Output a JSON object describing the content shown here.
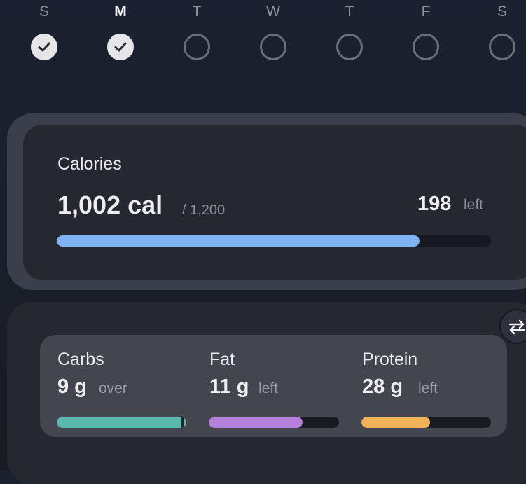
{
  "week": {
    "days": [
      {
        "letter": "S",
        "done": true
      },
      {
        "letter": "M",
        "done": true,
        "current": true
      },
      {
        "letter": "T",
        "done": false
      },
      {
        "letter": "W",
        "done": false
      },
      {
        "letter": "T",
        "done": false
      },
      {
        "letter": "F",
        "done": false
      },
      {
        "letter": "S",
        "done": false
      }
    ]
  },
  "calories": {
    "title": "Calories",
    "consumed": "1,002 cal",
    "goal": "/ 1,200",
    "remaining": "198",
    "remaining_label": "left",
    "progress": 0.835,
    "bar_color": "#7fb4f4"
  },
  "macros": {
    "swap_icon": "swap-arrows-icon",
    "items": [
      {
        "name": "Carbs",
        "amount": "9 g",
        "status": "over",
        "progress": 1.0,
        "color": "#5bb8ad"
      },
      {
        "name": "Fat",
        "amount": "11 g",
        "status": "left",
        "progress": 0.72,
        "color": "#b57fdc"
      },
      {
        "name": "Protein",
        "amount": "28 g",
        "status": "left",
        "progress": 0.53,
        "color": "#f0b35a"
      }
    ]
  }
}
